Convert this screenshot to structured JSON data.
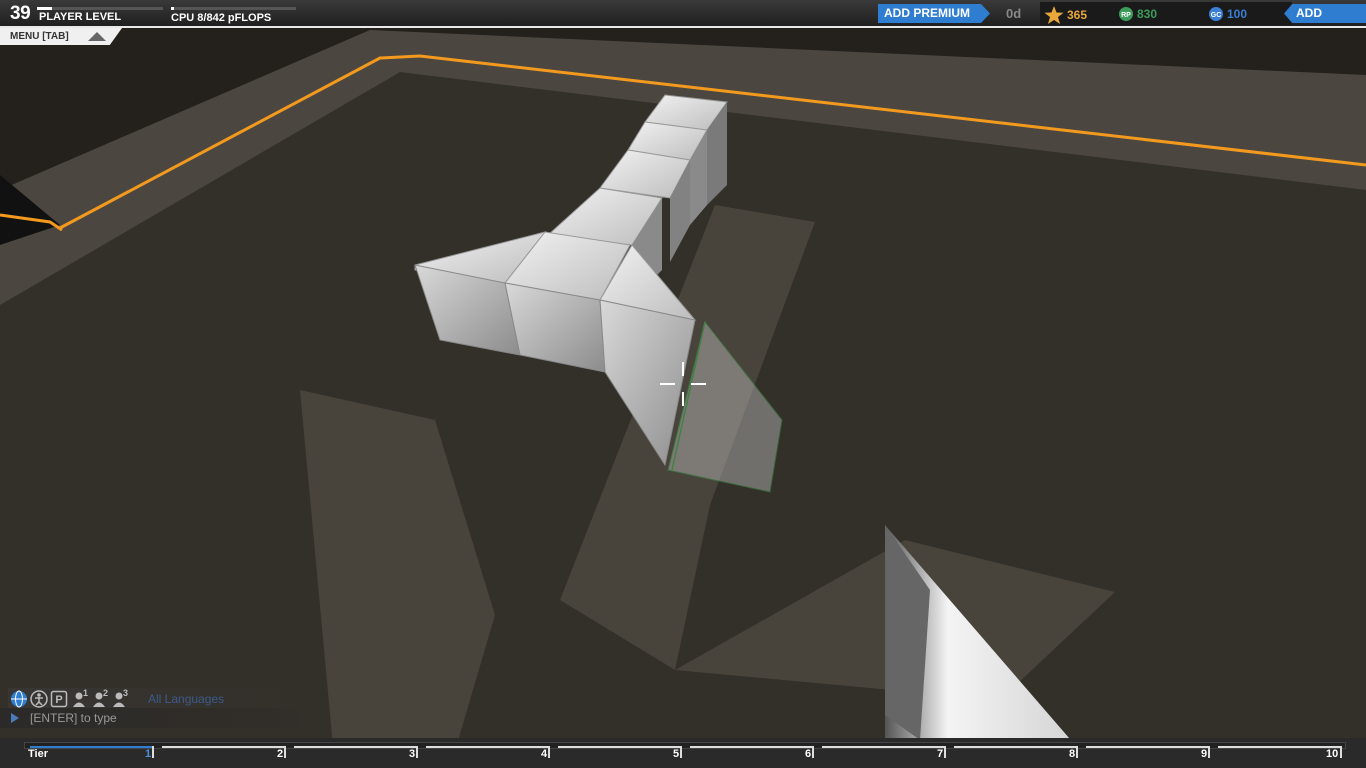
{
  "player": {
    "level": "39",
    "level_label": "PLAYER LEVEL",
    "level_progress": 0.12
  },
  "cpu": {
    "label": "CPU 8/842 pFLOPS",
    "used": 8,
    "max": 842
  },
  "premium": {
    "button_label": "ADD PREMIUM",
    "days": "0d"
  },
  "currencies": [
    {
      "icon": "star-icon",
      "value": "365",
      "color": "#e8a83a"
    },
    {
      "icon": "rp-icon",
      "value": "830",
      "color": "#3d9c5a"
    },
    {
      "icon": "gc-icon",
      "value": "100",
      "color": "#3a7fd6"
    }
  ],
  "funds": {
    "button_label": "ADD FUNDS"
  },
  "menu": {
    "label": "MENU [TAB]"
  },
  "chat": {
    "language": "All Languages",
    "placeholder": "[ENTER] to type",
    "channel_icons": [
      "globe-icon",
      "person-icon",
      "party-icon",
      "user-1-icon",
      "user-2-icon",
      "user-3-icon"
    ],
    "channel_numbers": [
      "1",
      "2",
      "3"
    ]
  },
  "tier": {
    "label": "Tier",
    "ticks": [
      "1",
      "2",
      "3",
      "4",
      "5",
      "6",
      "7",
      "8",
      "9",
      "10"
    ],
    "current": 1
  },
  "colors": {
    "accent": "#2f7dd1",
    "floor_trim": "#f39a1e",
    "floor": "#332f29"
  }
}
